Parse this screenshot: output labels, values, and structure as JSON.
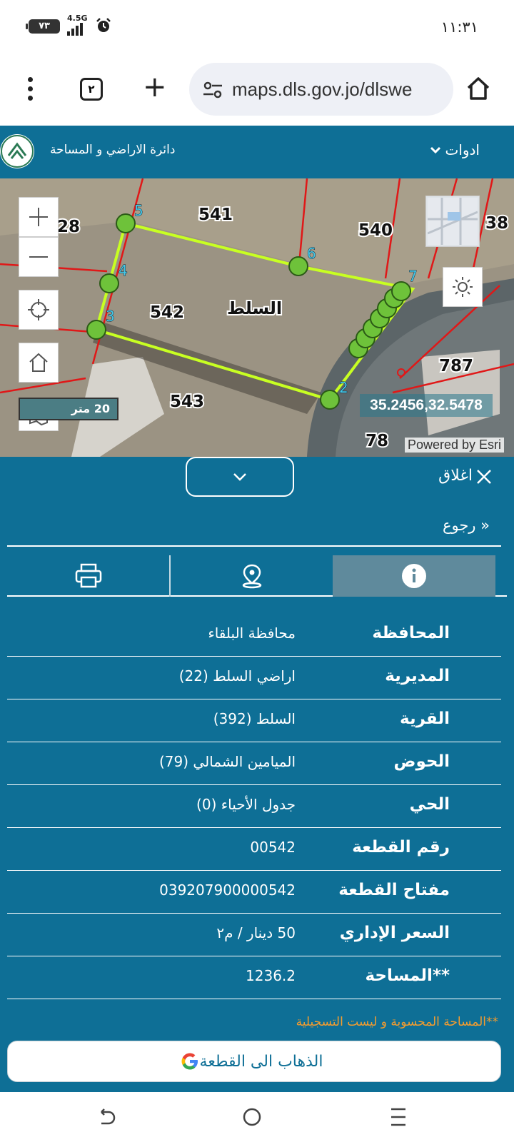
{
  "status_bar": {
    "time": "١١:٣١",
    "battery": "٧٣",
    "network": "4.5G"
  },
  "browser": {
    "tab_count": "٢",
    "url": "maps.dls.gov.jo/dlswe"
  },
  "app_header": {
    "org_name": "دائرة الاراضي و المساحة",
    "tools_label": "ادوات"
  },
  "map": {
    "parcel_labels": [
      "541",
      "540",
      "542",
      "543",
      "28",
      "38",
      "787",
      "78"
    ],
    "vertex_labels": [
      "2",
      "3",
      "4",
      "5",
      "6",
      "7"
    ],
    "town_label": "السلط",
    "scale": "20 متر",
    "coordinates": "35.2456,32.5478",
    "attribution": "Powered by Esri"
  },
  "panel": {
    "close_label": "اغلاق",
    "back_label": "رجوع",
    "rows": [
      {
        "label": "المحافظة",
        "value": "محافظة البلقاء"
      },
      {
        "label": "المديرية",
        "value": "اراضي السلط (22)"
      },
      {
        "label": "القرية",
        "value": "السلط (392)"
      },
      {
        "label": "الحوض",
        "value": "الميامين الشمالي (79)"
      },
      {
        "label": "الحي",
        "value": "جدول الأحياء (0)"
      },
      {
        "label": "رقم القطعة",
        "value": "00542"
      },
      {
        "label": "مفتاح القطعة",
        "value": "039207900000542"
      },
      {
        "label": "السعر الإداري",
        "value": "50 دينار / م٢"
      },
      {
        "label": "**المساحة",
        "value": "1236.2"
      }
    ],
    "note": "**المساحة المحسوبة و ليست التسجيلية",
    "goto_label": "الذهاب الى القطعة"
  }
}
